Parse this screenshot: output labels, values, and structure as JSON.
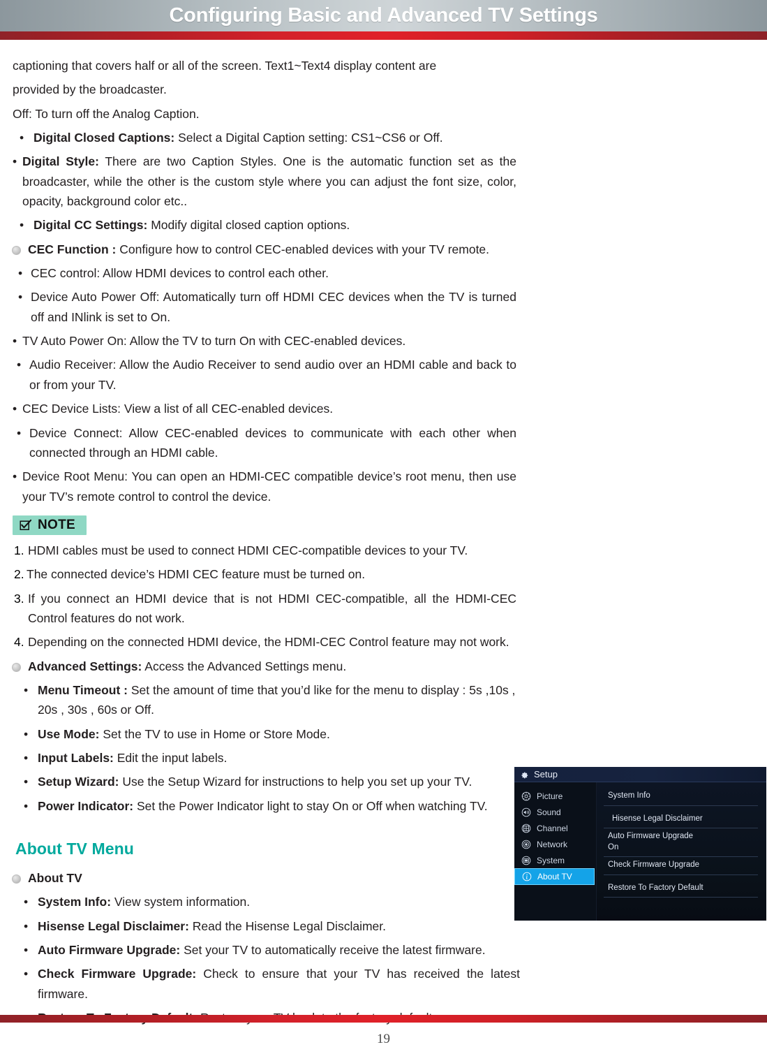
{
  "header": {
    "title": "Configuring Basic and Advanced TV Settings",
    "accent_color": "#d3212a",
    "bar_color": "#b4bdc1"
  },
  "body": {
    "intro_line1": "captioning that covers half or all of the screen. Text1~Text4 display content are",
    "intro_line2": "provided by the broadcaster.",
    "intro_line3": "Off: To turn off the Analog Caption.",
    "bullet_digital_closed_captions": {
      "marker": "•",
      "term": "Digital Closed Captions:",
      "desc": " Select a Digital Caption setting: CS1~CS6 or Off."
    },
    "bullet_digital_style": {
      "marker": "•",
      "term": "Digital Style:",
      "desc": " There are two Caption Styles. One is the automatic function set as the broadcaster, while the other is the custom style where you can adjust the font size, color, opacity, background color etc.."
    },
    "bullet_digital_cc_settings": {
      "marker": "•",
      "term": "Digital CC Settings:",
      "desc": " Modify digital closed caption options."
    },
    "section_cec": {
      "term": "CEC Function :",
      "desc": " Configure how to control CEC-enabled devices with your TV remote."
    },
    "cec_items": [
      {
        "marker": "•",
        "text": "CEC control: Allow HDMI devices to control each other."
      },
      {
        "marker": "•",
        "text": "Device Auto Power Off: Automatically turn off HDMI CEC devices when the TV is turned off and INlink is set to On."
      },
      {
        "marker": "•",
        "text": "TV Auto Power On: Allow the TV to turn On with CEC-enabled devices."
      },
      {
        "marker": "•",
        "text": "Audio Receiver: Allow the Audio Receiver to send audio over an HDMI cable and back to or from your TV."
      },
      {
        "marker": "•",
        "text": "CEC Device Lists: View a list of all CEC-enabled devices."
      },
      {
        "marker": "•",
        "text": "Device Connect: Allow CEC-enabled devices to communicate with each other when connected through an HDMI cable."
      },
      {
        "marker": "•",
        "text": "Device Root Menu: You can open an HDMI-CEC compatible device’s root menu, then use your TV’s remote control to control the device."
      }
    ],
    "note": {
      "label": "NOTE",
      "badge_color": "#8fd8c4",
      "items": [
        {
          "num": "1.",
          "text": "HDMI cables must be used to connect HDMI CEC-compatible devices to your TV."
        },
        {
          "num": "2.",
          "text": "The connected device’s HDMI CEC feature must be turned on."
        },
        {
          "num": "3.",
          "text": "If you connect an HDMI device that is not HDMI CEC-compatible, all the HDMI-CEC Control features do not work."
        },
        {
          "num": "4.",
          "text": "Depending on the connected HDMI device, the HDMI-CEC Control feature may not work."
        }
      ]
    },
    "section_advanced": {
      "term": "Advanced Settings:",
      "desc": " Access the Advanced Settings menu."
    },
    "advanced_items": [
      {
        "marker": "•",
        "term": "Menu Timeout :",
        "desc": " Set the amount of time that you’d like for the menu to display : 5s ,10s , 20s , 30s , 60s or Off."
      },
      {
        "marker": "•",
        "term": "Use Mode:",
        "desc": " Set the TV to use in Home or Store Mode."
      },
      {
        "marker": "•",
        "term": "Input Labels:",
        "desc": " Edit the input labels."
      },
      {
        "marker": "•",
        "term": "Setup Wizard:",
        "desc": " Use the Setup Wizard for instructions to help you set up your TV."
      },
      {
        "marker": "•",
        "term": "Power Indicator:",
        "desc": " Set the Power Indicator light to stay On or Off when watching TV."
      }
    ],
    "about_tv_menu_heading": "About TV Menu",
    "about_heading_color": "#00a99d",
    "section_about_tv": {
      "term": "About TV",
      "desc": ""
    },
    "about_items": [
      {
        "marker": "•",
        "term": "System Info:",
        "desc": " View system information."
      },
      {
        "marker": "•",
        "term": " Hisense Legal Disclaimer:",
        "desc": " Read the Hisense Legal Disclaimer."
      },
      {
        "marker": "•",
        "term": "Auto Firmware Upgrade:",
        "desc": " Set your TV to automatically receive the latest firmware."
      },
      {
        "marker": "•",
        "term": "Check Firmware Upgrade:",
        "desc": " Check to ensure that your TV has received the latest firmware."
      },
      {
        "marker": "•",
        "term": "Restore To Factory Default:",
        "desc": " Restore your TV back to the factory default."
      }
    ]
  },
  "osd": {
    "title": "Setup",
    "highlight_color": "#14a3e8",
    "sidebar": [
      {
        "label": "Picture",
        "icon": "picture-icon",
        "active": false
      },
      {
        "label": "Sound",
        "icon": "sound-icon",
        "active": false
      },
      {
        "label": "Channel",
        "icon": "channel-icon",
        "active": false
      },
      {
        "label": "Network",
        "icon": "network-icon",
        "active": false
      },
      {
        "label": "System",
        "icon": "system-icon",
        "active": false
      },
      {
        "label": "About TV",
        "icon": "info-icon",
        "active": true
      }
    ],
    "entries": [
      {
        "label": "System Info",
        "value": ""
      },
      {
        "label": " Hisense Legal Disclaimer",
        "value": ""
      },
      {
        "label": "Auto Firmware Upgrade",
        "value": "On"
      },
      {
        "label": "Check Firmware Upgrade",
        "value": ""
      },
      {
        "label": "Restore To Factory Default",
        "value": ""
      }
    ]
  },
  "footer": {
    "page_number": "19"
  }
}
